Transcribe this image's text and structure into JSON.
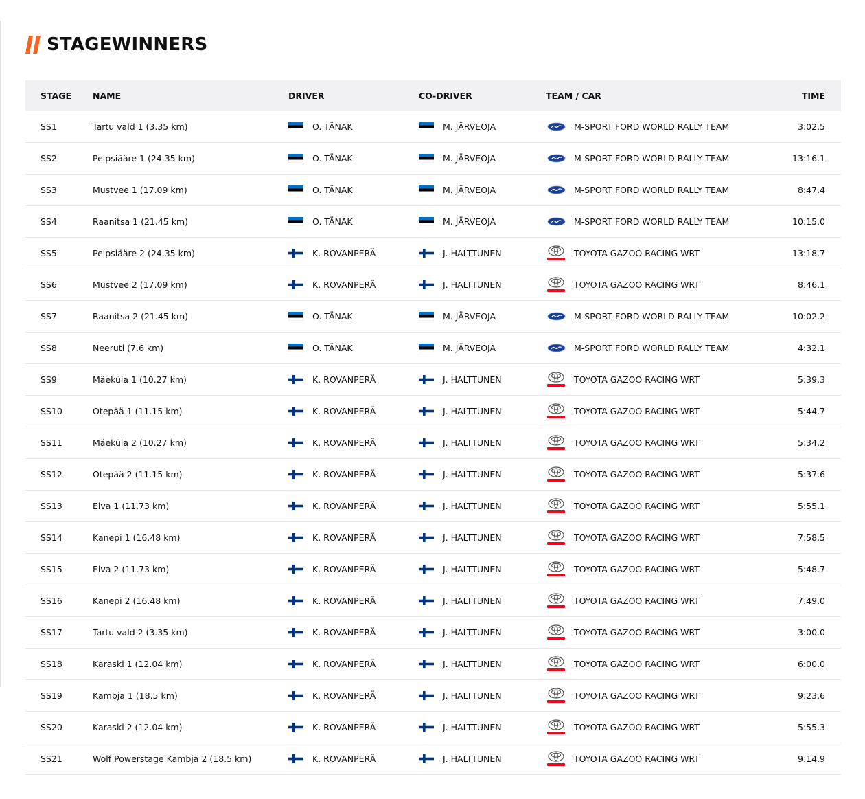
{
  "page": {
    "title": "STAGEWINNERS"
  },
  "columns": {
    "stage": "STAGE",
    "name": "NAME",
    "driver": "DRIVER",
    "codriver": "CO-DRIVER",
    "team": "TEAM / CAR",
    "time": "TIME"
  },
  "colors": {
    "accent": "#f26522",
    "est_blue": "#0072ce",
    "fin_blue": "#003580",
    "ford_blue": "#1c3f94",
    "toyota_red": "#eb0a1e"
  },
  "rows": [
    {
      "stage": "SS1",
      "name": "Tartu vald 1 (3.35 km)",
      "driver": "O. TÄNAK",
      "driver_flag": "estonia-flag-icon",
      "codriver": "M. JÄRVEOJA",
      "codriver_flag": "estonia-flag-icon",
      "team": "M-SPORT FORD WORLD RALLY TEAM",
      "team_logo": "ford-logo-icon",
      "time": "3:02.5"
    },
    {
      "stage": "SS2",
      "name": "Peipsiääre 1 (24.35 km)",
      "driver": "O. TÄNAK",
      "driver_flag": "estonia-flag-icon",
      "codriver": "M. JÄRVEOJA",
      "codriver_flag": "estonia-flag-icon",
      "team": "M-SPORT FORD WORLD RALLY TEAM",
      "team_logo": "ford-logo-icon",
      "time": "13:16.1"
    },
    {
      "stage": "SS3",
      "name": "Mustvee 1 (17.09 km)",
      "driver": "O. TÄNAK",
      "driver_flag": "estonia-flag-icon",
      "codriver": "M. JÄRVEOJA",
      "codriver_flag": "estonia-flag-icon",
      "team": "M-SPORT FORD WORLD RALLY TEAM",
      "team_logo": "ford-logo-icon",
      "time": "8:47.4"
    },
    {
      "stage": "SS4",
      "name": "Raanitsa 1 (21.45 km)",
      "driver": "O. TÄNAK",
      "driver_flag": "estonia-flag-icon",
      "codriver": "M. JÄRVEOJA",
      "codriver_flag": "estonia-flag-icon",
      "team": "M-SPORT FORD WORLD RALLY TEAM",
      "team_logo": "ford-logo-icon",
      "time": "10:15.0"
    },
    {
      "stage": "SS5",
      "name": "Peipsiääre 2 (24.35 km)",
      "driver": "K. ROVANPERÄ",
      "driver_flag": "finland-flag-icon",
      "codriver": "J. HALTTUNEN",
      "codriver_flag": "finland-flag-icon",
      "team": "TOYOTA GAZOO RACING WRT",
      "team_logo": "toyota-logo-icon",
      "time": "13:18.7"
    },
    {
      "stage": "SS6",
      "name": "Mustvee 2 (17.09 km)",
      "driver": "K. ROVANPERÄ",
      "driver_flag": "finland-flag-icon",
      "codriver": "J. HALTTUNEN",
      "codriver_flag": "finland-flag-icon",
      "team": "TOYOTA GAZOO RACING WRT",
      "team_logo": "toyota-logo-icon",
      "time": "8:46.1"
    },
    {
      "stage": "SS7",
      "name": "Raanitsa 2 (21.45 km)",
      "driver": "O. TÄNAK",
      "driver_flag": "estonia-flag-icon",
      "codriver": "M. JÄRVEOJA",
      "codriver_flag": "estonia-flag-icon",
      "team": "M-SPORT FORD WORLD RALLY TEAM",
      "team_logo": "ford-logo-icon",
      "time": "10:02.2"
    },
    {
      "stage": "SS8",
      "name": "Neeruti (7.6 km)",
      "driver": "O. TÄNAK",
      "driver_flag": "estonia-flag-icon",
      "codriver": "M. JÄRVEOJA",
      "codriver_flag": "estonia-flag-icon",
      "team": "M-SPORT FORD WORLD RALLY TEAM",
      "team_logo": "ford-logo-icon",
      "time": "4:32.1"
    },
    {
      "stage": "SS9",
      "name": "Mäeküla 1 (10.27 km)",
      "driver": "K. ROVANPERÄ",
      "driver_flag": "finland-flag-icon",
      "codriver": "J. HALTTUNEN",
      "codriver_flag": "finland-flag-icon",
      "team": "TOYOTA GAZOO RACING WRT",
      "team_logo": "toyota-logo-icon",
      "time": "5:39.3"
    },
    {
      "stage": "SS10",
      "name": "Otepää 1 (11.15 km)",
      "driver": "K. ROVANPERÄ",
      "driver_flag": "finland-flag-icon",
      "codriver": "J. HALTTUNEN",
      "codriver_flag": "finland-flag-icon",
      "team": "TOYOTA GAZOO RACING WRT",
      "team_logo": "toyota-logo-icon",
      "time": "5:44.7"
    },
    {
      "stage": "SS11",
      "name": "Mäeküla 2 (10.27 km)",
      "driver": "K. ROVANPERÄ",
      "driver_flag": "finland-flag-icon",
      "codriver": "J. HALTTUNEN",
      "codriver_flag": "finland-flag-icon",
      "team": "TOYOTA GAZOO RACING WRT",
      "team_logo": "toyota-logo-icon",
      "time": "5:34.2"
    },
    {
      "stage": "SS12",
      "name": "Otepää 2 (11.15 km)",
      "driver": "K. ROVANPERÄ",
      "driver_flag": "finland-flag-icon",
      "codriver": "J. HALTTUNEN",
      "codriver_flag": "finland-flag-icon",
      "team": "TOYOTA GAZOO RACING WRT",
      "team_logo": "toyota-logo-icon",
      "time": "5:37.6"
    },
    {
      "stage": "SS13",
      "name": "Elva 1 (11.73 km)",
      "driver": "K. ROVANPERÄ",
      "driver_flag": "finland-flag-icon",
      "codriver": "J. HALTTUNEN",
      "codriver_flag": "finland-flag-icon",
      "team": "TOYOTA GAZOO RACING WRT",
      "team_logo": "toyota-logo-icon",
      "time": "5:55.1"
    },
    {
      "stage": "SS14",
      "name": "Kanepi 1 (16.48 km)",
      "driver": "K. ROVANPERÄ",
      "driver_flag": "finland-flag-icon",
      "codriver": "J. HALTTUNEN",
      "codriver_flag": "finland-flag-icon",
      "team": "TOYOTA GAZOO RACING WRT",
      "team_logo": "toyota-logo-icon",
      "time": "7:58.5"
    },
    {
      "stage": "SS15",
      "name": "Elva 2 (11.73 km)",
      "driver": "K. ROVANPERÄ",
      "driver_flag": "finland-flag-icon",
      "codriver": "J. HALTTUNEN",
      "codriver_flag": "finland-flag-icon",
      "team": "TOYOTA GAZOO RACING WRT",
      "team_logo": "toyota-logo-icon",
      "time": "5:48.7"
    },
    {
      "stage": "SS16",
      "name": "Kanepi 2 (16.48 km)",
      "driver": "K. ROVANPERÄ",
      "driver_flag": "finland-flag-icon",
      "codriver": "J. HALTTUNEN",
      "codriver_flag": "finland-flag-icon",
      "team": "TOYOTA GAZOO RACING WRT",
      "team_logo": "toyota-logo-icon",
      "time": "7:49.0"
    },
    {
      "stage": "SS17",
      "name": "Tartu vald 2 (3.35 km)",
      "driver": "K. ROVANPERÄ",
      "driver_flag": "finland-flag-icon",
      "codriver": "J. HALTTUNEN",
      "codriver_flag": "finland-flag-icon",
      "team": "TOYOTA GAZOO RACING WRT",
      "team_logo": "toyota-logo-icon",
      "time": "3:00.0"
    },
    {
      "stage": "SS18",
      "name": "Karaski 1 (12.04 km)",
      "driver": "K. ROVANPERÄ",
      "driver_flag": "finland-flag-icon",
      "codriver": "J. HALTTUNEN",
      "codriver_flag": "finland-flag-icon",
      "team": "TOYOTA GAZOO RACING WRT",
      "team_logo": "toyota-logo-icon",
      "time": "6:00.0"
    },
    {
      "stage": "SS19",
      "name": "Kambja 1 (18.5 km)",
      "driver": "K. ROVANPERÄ",
      "driver_flag": "finland-flag-icon",
      "codriver": "J. HALTTUNEN",
      "codriver_flag": "finland-flag-icon",
      "team": "TOYOTA GAZOO RACING WRT",
      "team_logo": "toyota-logo-icon",
      "time": "9:23.6"
    },
    {
      "stage": "SS20",
      "name": "Karaski 2 (12.04 km)",
      "driver": "K. ROVANPERÄ",
      "driver_flag": "finland-flag-icon",
      "codriver": "J. HALTTUNEN",
      "codriver_flag": "finland-flag-icon",
      "team": "TOYOTA GAZOO RACING WRT",
      "team_logo": "toyota-logo-icon",
      "time": "5:55.3"
    },
    {
      "stage": "SS21",
      "name": "Wolf Powerstage Kambja 2 (18.5 km)",
      "driver": "K. ROVANPERÄ",
      "driver_flag": "finland-flag-icon",
      "codriver": "J. HALTTUNEN",
      "codriver_flag": "finland-flag-icon",
      "team": "TOYOTA GAZOO RACING WRT",
      "team_logo": "toyota-logo-icon",
      "time": "9:14.9"
    }
  ]
}
